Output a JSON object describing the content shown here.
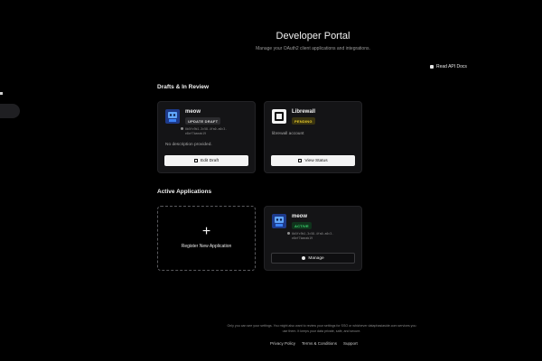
{
  "header": {
    "title": "Developer Portal",
    "subtitle": "Manage your OAuth2 client applications and integrations.",
    "api_docs_label": "Read API Docs"
  },
  "drafts": {
    "title": "Drafts & In Review",
    "cards": [
      {
        "name": "meow",
        "badge": "UPDATE DRAFT",
        "client_id": "0b5fc9b1-3c58-4fa0-a0c3-e8ef7baeab19",
        "description": "No description provided.",
        "button": "Edit Draft"
      },
      {
        "name": "Librewall",
        "badge": "PENDING",
        "description": "librewall account",
        "button": "View Status"
      }
    ]
  },
  "active": {
    "title": "Active Applications",
    "register_label": "Register New Application",
    "register_icon": "plus-icon",
    "cards": [
      {
        "name": "meow",
        "badge": "ACTIVE",
        "client_id": "0b5fc9b1-3c58-4fa0-a0c3-e8ef7baeab19",
        "button": "Manage"
      }
    ]
  },
  "footer": {
    "note": "Only you can see your settings. You might also want to review your settings for SSO or whichever dataphasiaside.com services you use them. It keeps your data private, safe, and secure.",
    "links": [
      "Privacy Policy",
      "Terms & Conditions",
      "Support"
    ]
  },
  "colors": {
    "background": "#000000",
    "card": "#141416",
    "pending": "#e7c92c",
    "active": "#3ddc72"
  }
}
